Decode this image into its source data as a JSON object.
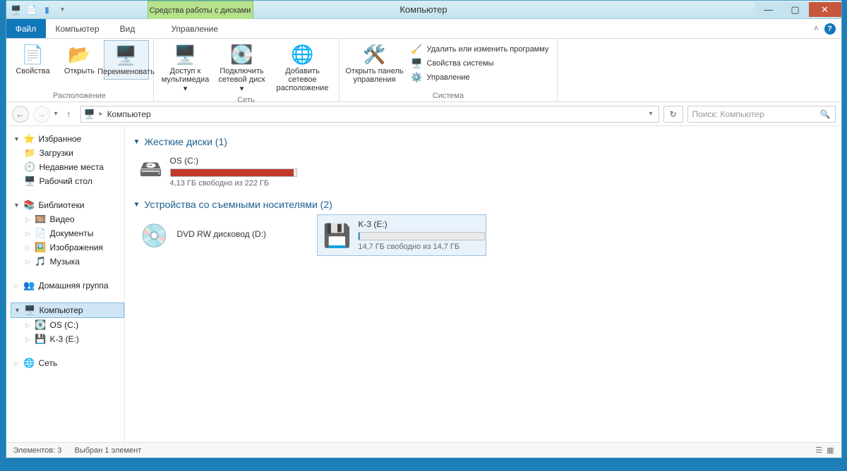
{
  "window": {
    "title": "Компьютер"
  },
  "contextual_tab": "Средства работы с дисками",
  "tabs": {
    "file": "Файл",
    "computer": "Компьютер",
    "view": "Вид",
    "manage": "Управление"
  },
  "ribbon": {
    "location_group": "Расположение",
    "properties": "Свойства",
    "open": "Открыть",
    "rename": "Переименовать",
    "network_group": "Сеть",
    "media_access": "Доступ к мультимедиа ▾",
    "map_drive": "Подключить сетевой диск ▾",
    "add_net_location": "Добавить сетевое расположение",
    "system_group": "Система",
    "open_control_panel": "Открыть панель управления",
    "remove_change_program": "Удалить или изменить программу",
    "system_properties": "Свойства системы",
    "manage": "Управление"
  },
  "addressbar": {
    "crumb": "Компьютер"
  },
  "search": {
    "placeholder": "Поиск: Компьютер"
  },
  "tree": {
    "favorites": "Избранное",
    "downloads": "Загрузки",
    "recent": "Недавние места",
    "desktop": "Рабочий стол",
    "libraries": "Библиотеки",
    "video": "Видео",
    "documents": "Документы",
    "pictures": "Изображения",
    "music": "Музыка",
    "homegroup": "Домашняя группа",
    "computer": "Компьютер",
    "os_c": "OS (C:)",
    "k3_e": "K-3 (E:)",
    "network": "Сеть"
  },
  "groups": {
    "hard_disks": "Жесткие диски (1)",
    "removable": "Устройства со съемными носителями (2)"
  },
  "drives": {
    "os_c": {
      "name": "OS (C:)",
      "status": "4,13 ГБ свободно из 222 ГБ",
      "fill_pct": 98,
      "fill_color": "#c0392b"
    },
    "dvd": {
      "name": "DVD RW дисковод (D:)"
    },
    "k3": {
      "name": "K-3 (E:)",
      "status": "14,7 ГБ свободно из 14,7 ГБ",
      "fill_pct": 1,
      "fill_color": "#3498db"
    }
  },
  "statusbar": {
    "count": "Элементов: 3",
    "selection": "Выбран 1 элемент"
  }
}
